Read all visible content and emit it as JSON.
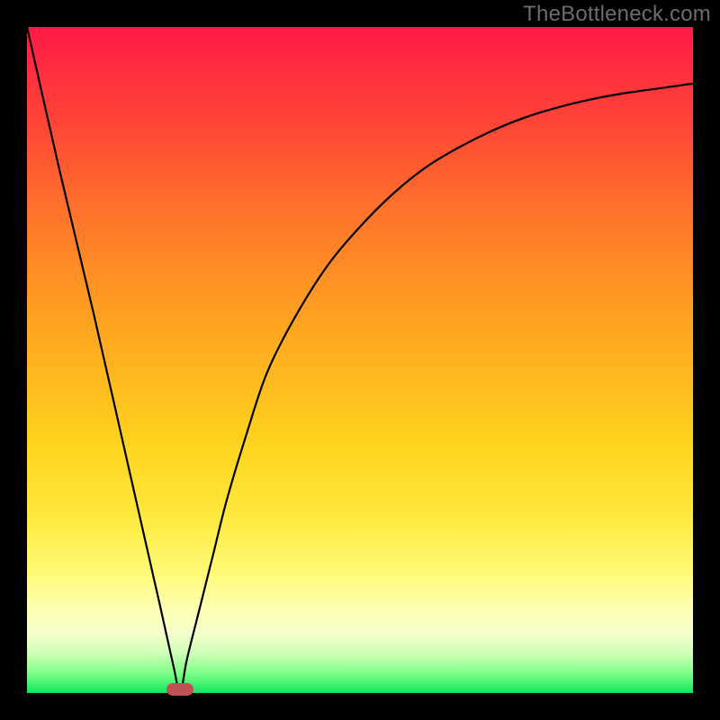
{
  "watermark": "TheBottleneck.com",
  "chart_data": {
    "type": "line",
    "title": "",
    "xlabel": "",
    "ylabel": "",
    "xlim": [
      0,
      100
    ],
    "ylim": [
      0,
      100
    ],
    "grid": false,
    "legend": false,
    "marker": {
      "x": 23,
      "y": 0,
      "color": "#c15055"
    },
    "series": [
      {
        "name": "curve",
        "color": "#000000",
        "x": [
          0,
          5,
          10,
          15,
          20,
          22,
          23,
          24,
          26,
          28,
          30,
          33,
          36,
          40,
          45,
          50,
          55,
          60,
          65,
          70,
          75,
          80,
          85,
          90,
          95,
          100
        ],
        "y": [
          100,
          78,
          57,
          35,
          13,
          4,
          0,
          5,
          13,
          21,
          29,
          39,
          48,
          56,
          64,
          70,
          75,
          79,
          82,
          84.5,
          86.5,
          88,
          89.2,
          90.1,
          90.8,
          91.5
        ]
      }
    ],
    "background_gradient": {
      "stops": [
        {
          "pos": 0,
          "color": "#ff1a47"
        },
        {
          "pos": 7,
          "color": "#ff2f3e"
        },
        {
          "pos": 16,
          "color": "#ff4a35"
        },
        {
          "pos": 26,
          "color": "#ff6e2c"
        },
        {
          "pos": 38,
          "color": "#ff9224"
        },
        {
          "pos": 50,
          "color": "#ffb21f"
        },
        {
          "pos": 62,
          "color": "#ffd21e"
        },
        {
          "pos": 73,
          "color": "#ffe83a"
        },
        {
          "pos": 82,
          "color": "#fffb78"
        },
        {
          "pos": 87,
          "color": "#feffae"
        },
        {
          "pos": 91,
          "color": "#f6ffcc"
        },
        {
          "pos": 94,
          "color": "#cfffb7"
        },
        {
          "pos": 97,
          "color": "#7fff88"
        },
        {
          "pos": 100,
          "color": "#11e65f"
        }
      ]
    }
  }
}
